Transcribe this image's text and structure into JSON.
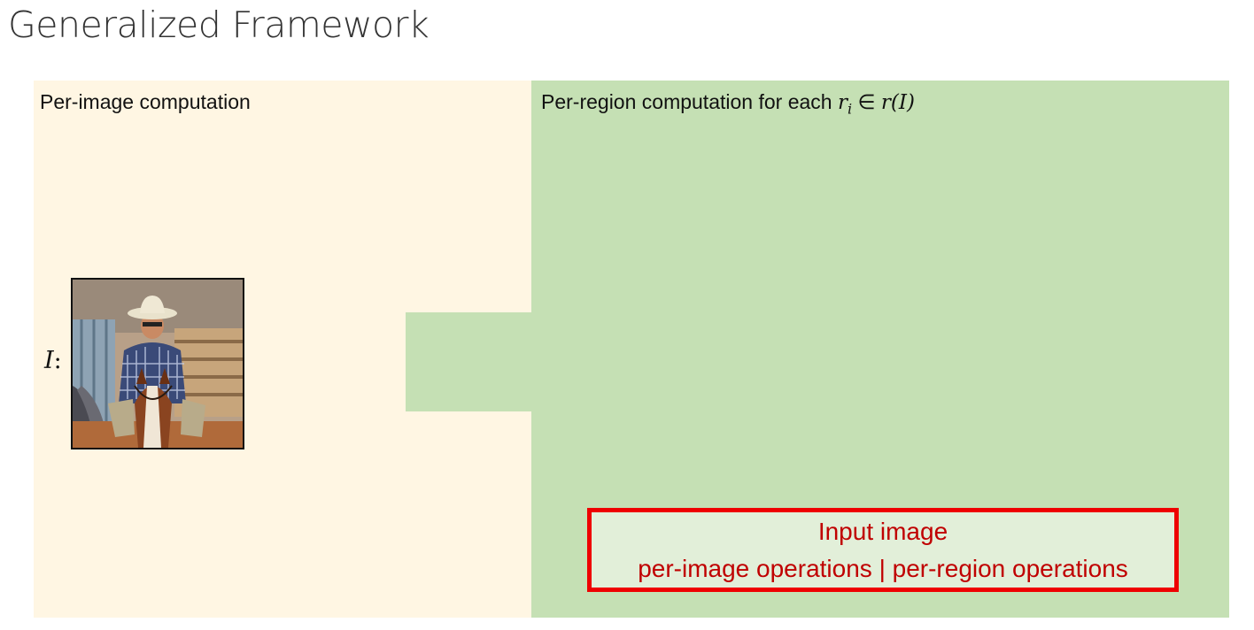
{
  "slide": {
    "title": "Generalized Framework"
  },
  "per_image_panel": {
    "label": "Per-image computation",
    "color": "#fff6e3",
    "input_variable": "I",
    "input_variable_suffix": ":",
    "photo_subject": "cowboy-on-horse"
  },
  "per_region_panel": {
    "label_prefix": "Per-region computation for each ",
    "label_r": "r",
    "label_sub": "i",
    "label_rest": " ∈ ",
    "label_math": "r(I)",
    "color": "#c5e0b4"
  },
  "legend": {
    "line1": "Input image",
    "line2": "per-image operations | per-region operations",
    "border_color": "#ee0000",
    "text_color": "#c00000"
  }
}
